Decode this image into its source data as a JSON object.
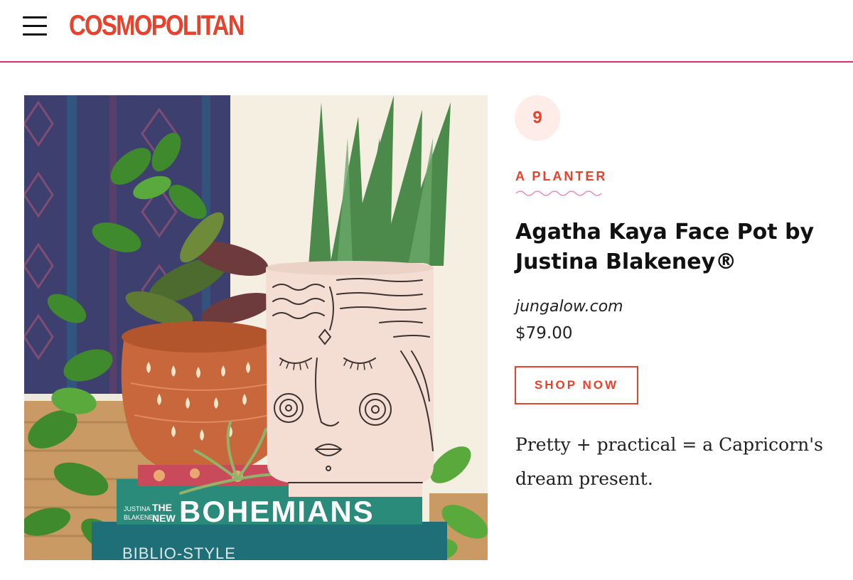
{
  "header": {
    "menu_icon": "hamburger-menu-icon",
    "logo_text": "COSMOPOLITAN",
    "brand_color": "#e8412c",
    "divider_color": "#e3247c"
  },
  "product": {
    "number": "9",
    "category": "A PLANTER",
    "title": "Agatha Kaya Face Pot by Justina Blakeney®",
    "retailer": "jungalow.com",
    "price": "$79.00",
    "shop_label": "SHOP NOW",
    "blurb": "Pretty + practical = a Capricorn's dream present.",
    "image_texts": {
      "book_title_prefix_top": "THE",
      "book_title_prefix_bottom": "NEW",
      "book_title": "BOHEMIANS",
      "book_author_top": "JUSTINA",
      "book_author_bottom": "BLAKENEY",
      "book2_title": "BIBLIO-STYLE"
    }
  }
}
